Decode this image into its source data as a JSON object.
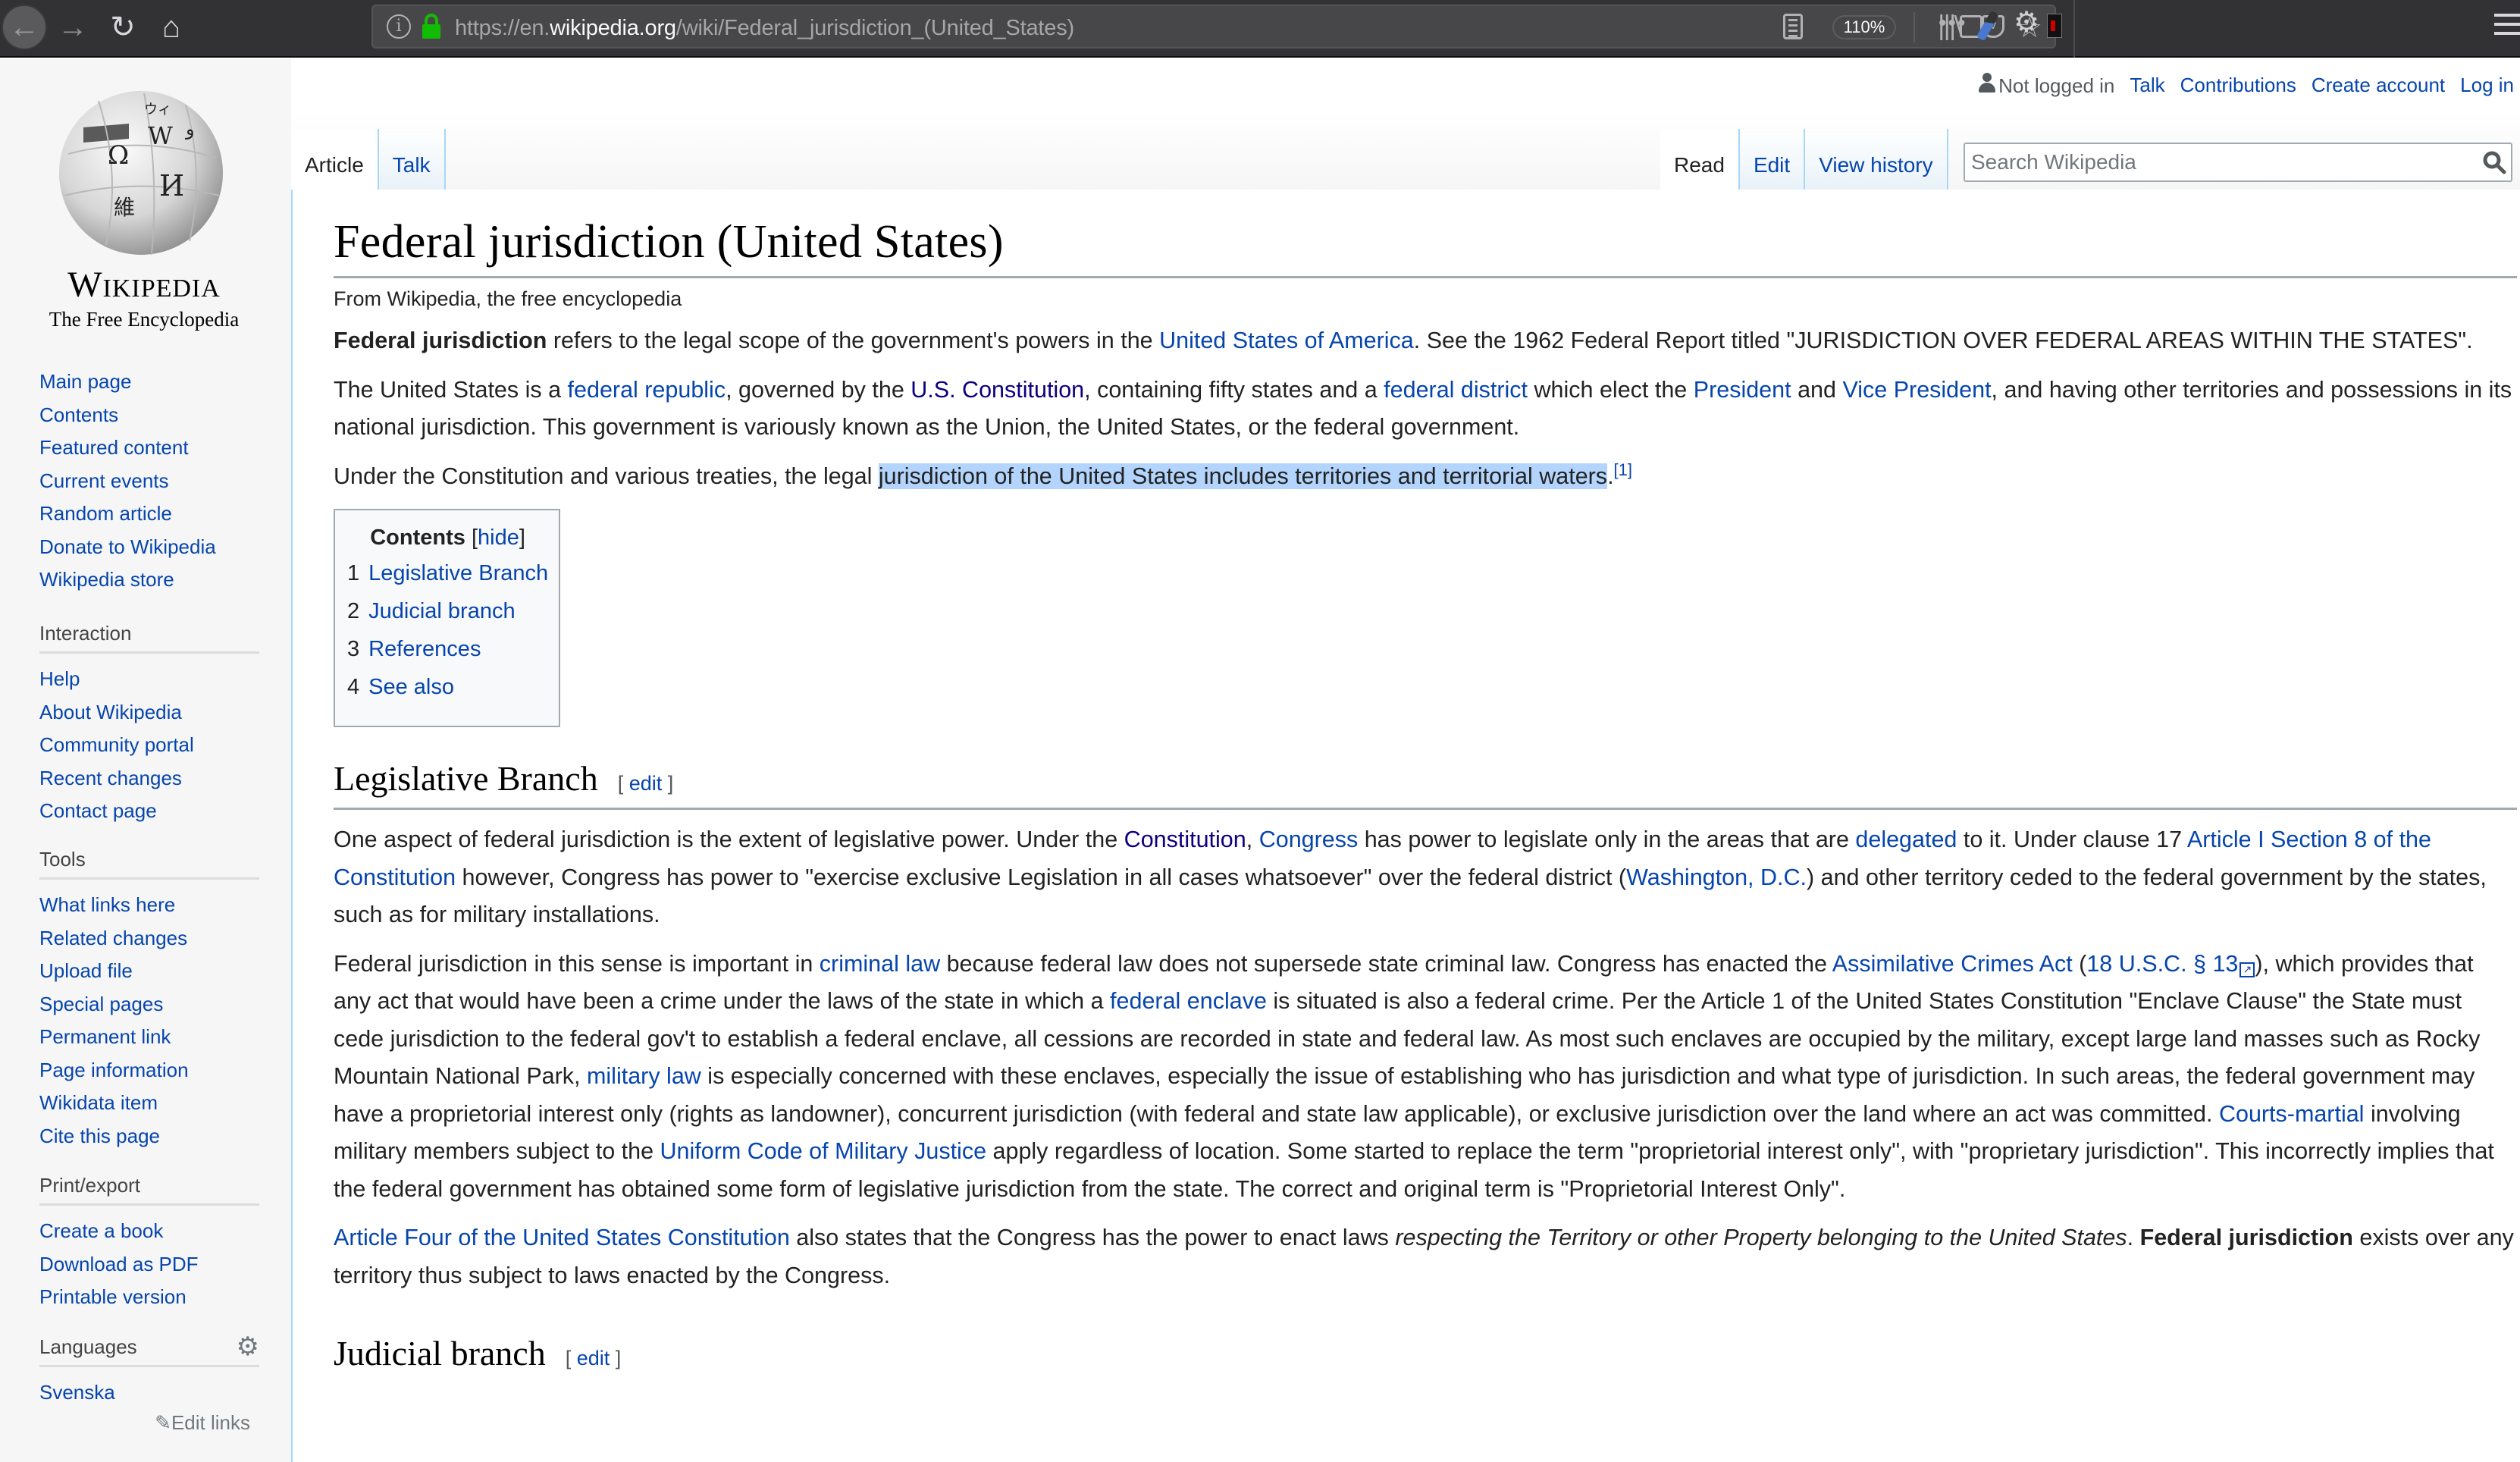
{
  "browser": {
    "url_prefix": "https://en.",
    "url_host": "wikipedia.org",
    "url_path": "/wiki/Federal_jurisdiction_(United_States)",
    "zoom_level": "110%",
    "icons": {
      "back": "←",
      "forward": "→",
      "reload": "↻",
      "home": "⌂",
      "info": "i",
      "page_actions": "•••",
      "bookmark_star": "☆",
      "gear": "⚙",
      "library": "|||\\"
    }
  },
  "logo": {
    "wordmark": "Wikipedia",
    "tagline": "The Free Encyclopedia",
    "globe_glyphs": [
      "Ω",
      "W",
      "И",
      "維",
      "ウィ",
      "ا"
    ]
  },
  "personal_tools": {
    "status": "Not logged in",
    "links": [
      "Talk",
      "Contributions",
      "Create account",
      "Log in"
    ]
  },
  "tabs": {
    "left": [
      {
        "label": "Article",
        "selected": true
      },
      {
        "label": "Talk",
        "selected": false
      }
    ],
    "right": [
      {
        "label": "Read",
        "selected": true
      },
      {
        "label": "Edit",
        "selected": false
      },
      {
        "label": "View history",
        "selected": false
      }
    ]
  },
  "search": {
    "placeholder": "Search Wikipedia",
    "value": ""
  },
  "sidebar": {
    "navigation": [
      "Main page",
      "Contents",
      "Featured content",
      "Current events",
      "Random article",
      "Donate to Wikipedia",
      "Wikipedia store"
    ],
    "interaction": {
      "heading": "Interaction",
      "items": [
        "Help",
        "About Wikipedia",
        "Community portal",
        "Recent changes",
        "Contact page"
      ]
    },
    "tools": {
      "heading": "Tools",
      "items": [
        "What links here",
        "Related changes",
        "Upload file",
        "Special pages",
        "Permanent link",
        "Page information",
        "Wikidata item",
        "Cite this page"
      ]
    },
    "print_export": {
      "heading": "Print/export",
      "items": [
        "Create a book",
        "Download as PDF",
        "Printable version"
      ]
    },
    "languages": {
      "heading": "Languages",
      "items": [
        "Svenska"
      ],
      "edit_links": "Edit links"
    }
  },
  "article": {
    "title": "Federal jurisdiction (United States)",
    "subtitle": "From Wikipedia, the free encyclopedia",
    "intro": {
      "p1": {
        "bold": "Federal jurisdiction",
        "t1": " refers to the legal scope of the government's powers in the ",
        "link1": "United States of America",
        "t2": ". See the 1962 Federal Report titled \"JURISDICTION OVER FEDERAL AREAS WITHIN THE STATES\"."
      },
      "p2": {
        "t1": "The United States is a ",
        "link1": "federal republic",
        "t2": ", governed by the ",
        "link2": "U.S. Constitution",
        "t3": ", containing fifty states and a ",
        "link3": "federal district",
        "t4": " which elect the ",
        "link4": "President",
        "t5": " and ",
        "link5": "Vice President",
        "t6": ", and having other territories and possessions in its national jurisdiction. This government is variously known as the Union, the United States, or the federal government."
      },
      "p3": {
        "t1": "Under the Constitution and various treaties, the legal ",
        "highlight": "jurisdiction of the United States includes territories and territorial waters",
        "t2": ".",
        "ref": "[1]"
      }
    },
    "toc": {
      "title": "Contents",
      "toggle_open": "[",
      "toggle": "hide",
      "toggle_close": "]",
      "items": [
        {
          "num": "1",
          "label": "Legislative Branch"
        },
        {
          "num": "2",
          "label": "Judicial branch"
        },
        {
          "num": "3",
          "label": "References"
        },
        {
          "num": "4",
          "label": "See also"
        }
      ]
    },
    "sections": {
      "legislative": {
        "heading": "Legislative Branch",
        "edit_open": "[ ",
        "edit": "edit",
        "edit_close": " ]",
        "p1": {
          "t1": "One aspect of federal jurisdiction is the extent of legislative power. Under the ",
          "link1": "Constitution",
          "t2": ", ",
          "link2": "Congress",
          "t3": " has power to legislate only in the areas that are ",
          "link3": "delegated",
          "t4": " to it. Under clause 17 ",
          "link4": "Article I Section 8 of the Constitution",
          "t5": " however, Congress has power to \"exercise exclusive Legislation in all cases whatsoever\" over the federal district (",
          "link5": "Washington, D.C.",
          "t6": ") and other territory ceded to the federal government by the states, such as for military installations."
        },
        "p2": {
          "t1": "Federal jurisdiction in this sense is important in ",
          "link1": "criminal law",
          "t2": " because federal law does not supersede state criminal law. Congress has enacted the ",
          "link2": "Assimilative Crimes Act",
          "t3": " (",
          "link3": "18 U.S.C. § 13",
          "t4": "), which provides that any act that would have been a crime under the laws of the state in which a ",
          "link4": "federal enclave",
          "t5": " is situated is also a federal crime. Per the Article 1 of the United States Constitution \"Enclave Clause\" the State must cede jurisdiction to the federal gov't to establish a federal enclave, all cessions are recorded in state and federal law. As most such enclaves are occupied by the military, except large land masses such as Rocky Mountain National Park, ",
          "link5": "military law",
          "t6": " is especially concerned with these enclaves, especially the issue of establishing who has jurisdiction and what type of jurisdiction. In such areas, the federal government may have a proprietorial interest only (rights as landowner), concurrent jurisdiction (with federal and state law applicable), or exclusive jurisdiction over the land where an act was committed. ",
          "link6": "Courts-martial",
          "t7": " involving military members subject to the ",
          "link7": "Uniform Code of Military Justice",
          "t8": " apply regardless of location. Some started to replace the term \"proprietorial interest only\", with \"proprietary jurisdiction\". This incorrectly implies that the federal government has obtained some form of legislative jurisdiction from the state. The correct and original term is \"Proprietorial Interest Only\"."
        },
        "p3": {
          "link1": "Article Four of the United States Constitution",
          "t1": " also states that the Congress has the power to enact laws ",
          "italic": "respecting the Territory or other Property belonging to the United States",
          "t2": ". ",
          "bold": "Federal jurisdiction",
          "t3": " exists over any territory thus subject to laws enacted by the Congress."
        }
      },
      "judicial": {
        "heading": "Judicial branch",
        "edit_open": "[ ",
        "edit": "edit",
        "edit_close": " ]"
      }
    }
  }
}
